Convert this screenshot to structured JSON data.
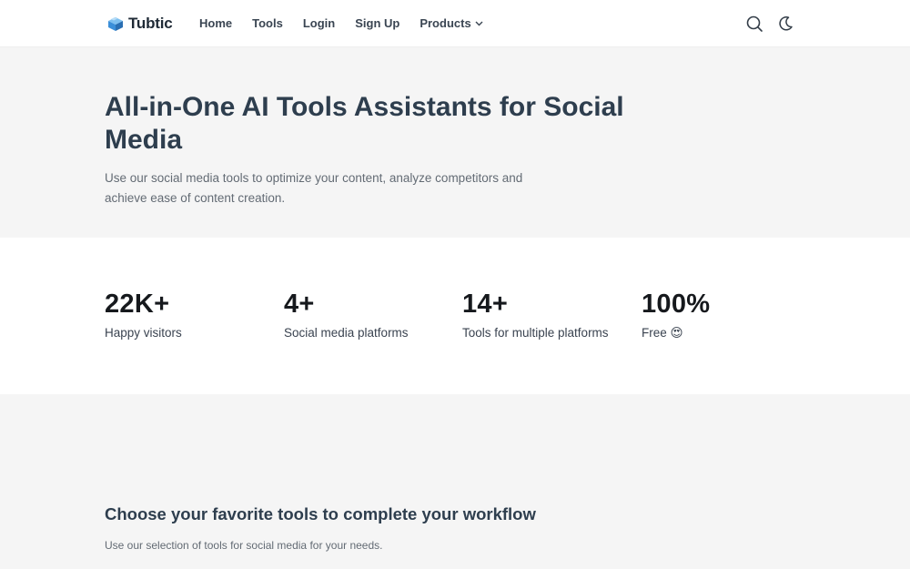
{
  "nav": {
    "brand": "Tubtic",
    "links": [
      "Home",
      "Tools",
      "Login",
      "Sign Up"
    ],
    "products_label": "Products",
    "icons": [
      "search-icon",
      "moon-icon"
    ]
  },
  "hero": {
    "title": "All-in-One AI Tools Assistants for Social Media",
    "subtitle": "Use our social media tools to optimize your content, analyze competitors and achieve ease of content creation."
  },
  "stats": [
    {
      "value": "22K+",
      "label": "Happy visitors"
    },
    {
      "value": "4+",
      "label": "Social media platforms"
    },
    {
      "value": "14+",
      "label": "Tools for multiple platforms"
    },
    {
      "value": "100%",
      "label": "Free 😍"
    }
  ],
  "workflow": {
    "title": "Choose your favorite tools to complete your workflow",
    "subtitle": "Use our selection of tools for social media for your needs."
  },
  "colors": {
    "logo_blue": "#3b8fd9",
    "heading": "#2e3e4e",
    "section_bg": "#f5f5f5"
  }
}
